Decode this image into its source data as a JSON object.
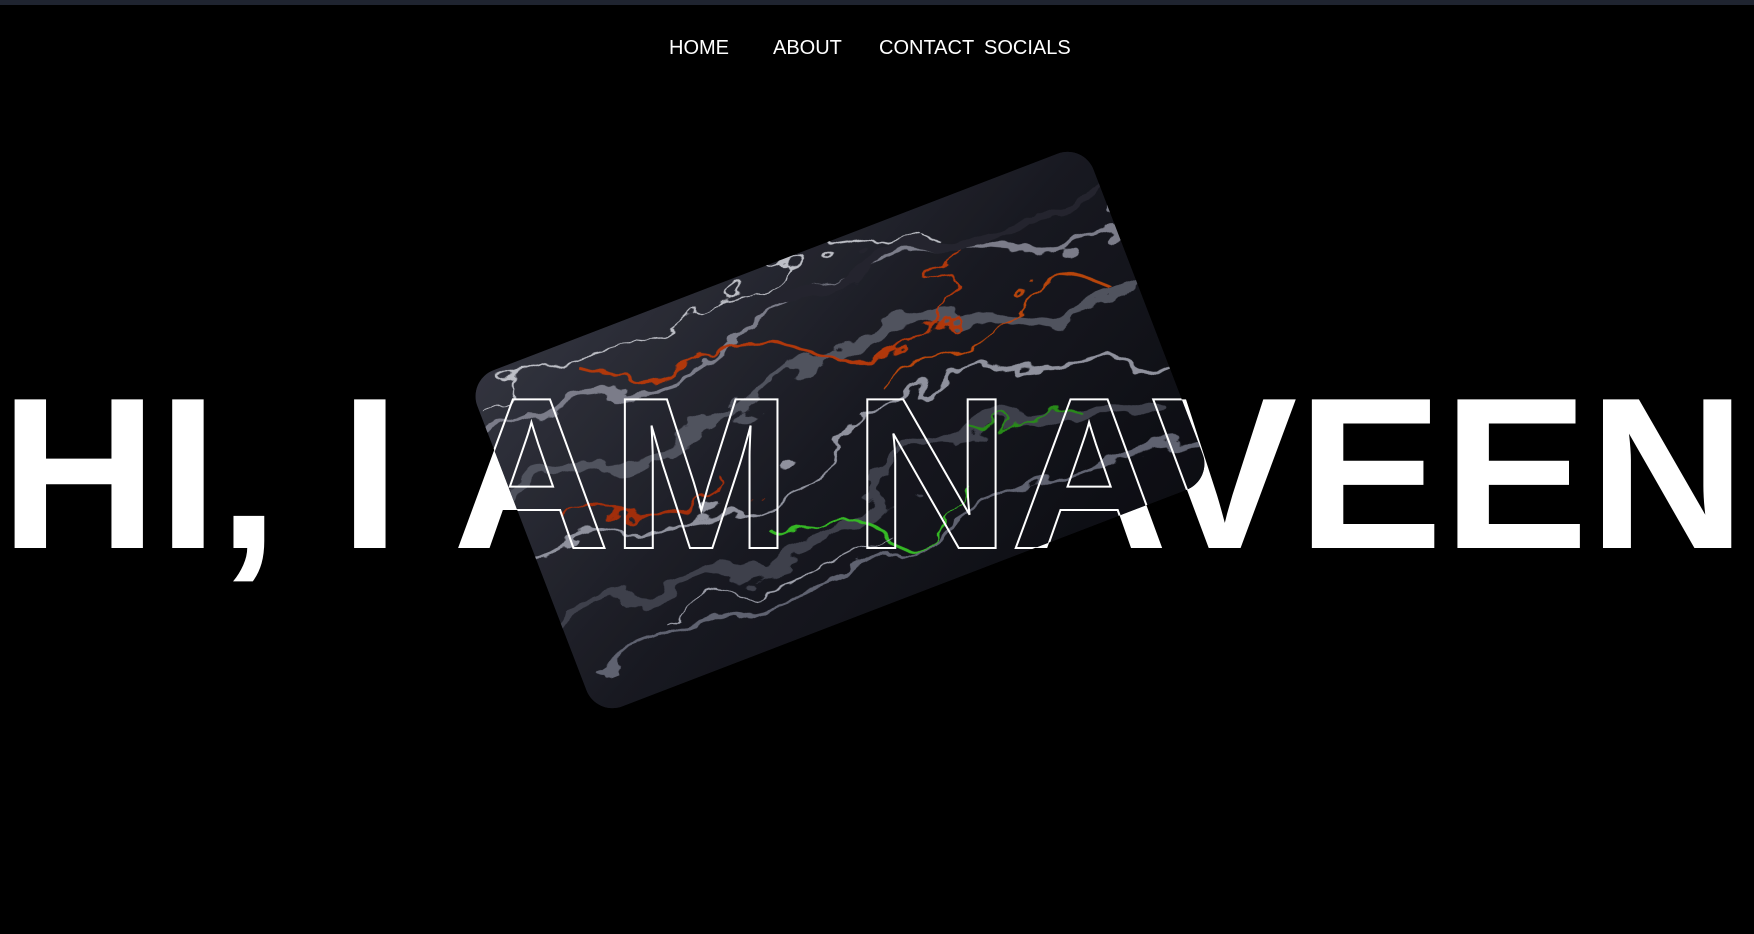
{
  "colors": {
    "background": "#000000",
    "top_bar": "#1f2430",
    "text": "#ffffff",
    "card_base": "#14151c"
  },
  "nav": {
    "items": [
      {
        "label": "HOME"
      },
      {
        "label": "ABOUT"
      },
      {
        "label": "CONTACT"
      },
      {
        "label": "SOCIALS"
      }
    ]
  },
  "hero": {
    "headline": "HI, I AM NAVEEN"
  },
  "card": {
    "image": "abstract-liquid-swirl-image"
  }
}
